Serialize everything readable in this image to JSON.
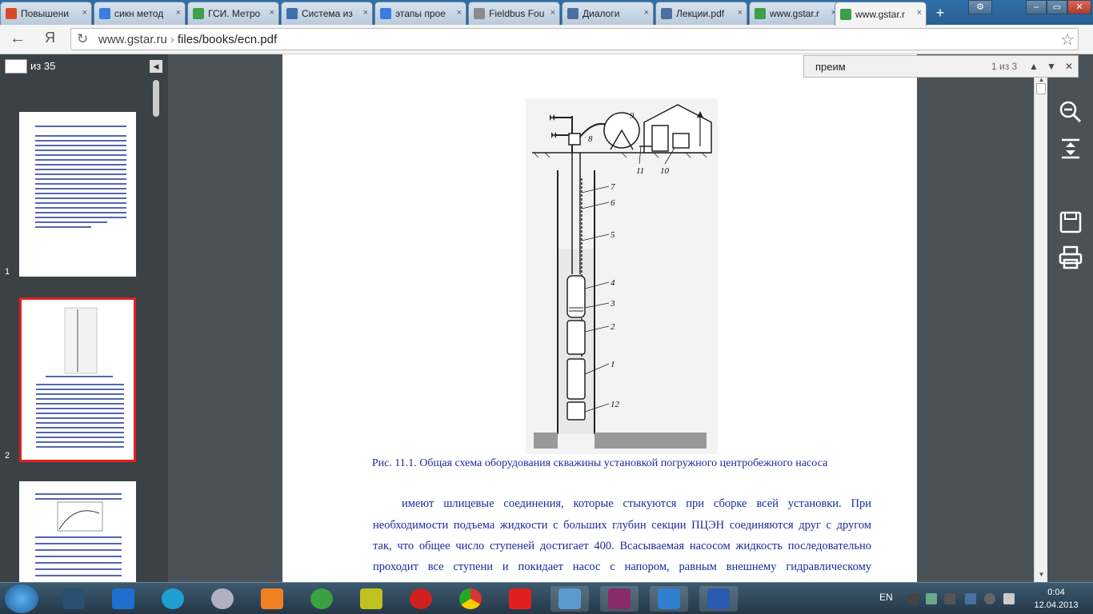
{
  "browser": {
    "tabs": [
      {
        "label": "Повышени",
        "icon": "page-icon",
        "color": "#d94a2b"
      },
      {
        "label": "сикн метод",
        "icon": "google-icon",
        "color": "#3b7de0"
      },
      {
        "label": "ГСИ. Метро",
        "icon": "gear-icon",
        "color": "#3aa04a"
      },
      {
        "label": "Система из",
        "icon": "page-icon",
        "color": "#3a6fb0"
      },
      {
        "label": "этапы прое",
        "icon": "google-icon",
        "color": "#3b7de0"
      },
      {
        "label": "Fieldbus Fou",
        "icon": "document-icon",
        "color": "#8a8a8a"
      },
      {
        "label": "Диалоги",
        "icon": "chat-icon",
        "color": "#4a6fa0"
      },
      {
        "label": "Лекции.pdf",
        "icon": "vk-icon",
        "color": "#4a6fa0"
      },
      {
        "label": "www.gstar.r",
        "icon": "globe-icon",
        "color": "#3aa04a"
      },
      {
        "label": "www.gstar.r",
        "icon": "globe-icon",
        "color": "#3aa04a"
      }
    ],
    "new_tab": "+",
    "yandex_letter": "Я",
    "url_host": "www.gstar.ru",
    "url_sep": "›",
    "url_path": "files/books/ecn.pdf"
  },
  "viewer": {
    "page_input": "",
    "page_total": "из 35",
    "thumbnails": [
      {
        "number": "1"
      },
      {
        "number": "2"
      }
    ]
  },
  "find": {
    "query": "преим",
    "count": "1 из 3"
  },
  "document": {
    "figure_labels": [
      "9",
      "8",
      "11",
      "10",
      "7",
      "6",
      "5",
      "4",
      "3",
      "2",
      "1",
      "12"
    ],
    "caption": "Рис. 11.1. Общая схема оборудования скважины установкой погружного центробежного насоса",
    "lines": [
      "имеют шлицевые соединения, которые стыкуются при сборке всей установки. При",
      "необходимости подъема жидкости с больших глубин секции ПЦЭН соединяются друг с другом",
      "так, что общее число ступеней достигает 400. Всасываемая насосом жидкость последовательно",
      "проходит все ступени и покидает насос с напором, равным внешнему гидравлическому"
    ]
  },
  "system": {
    "language": "EN",
    "time": "0:04",
    "date": "12.04.2013"
  }
}
